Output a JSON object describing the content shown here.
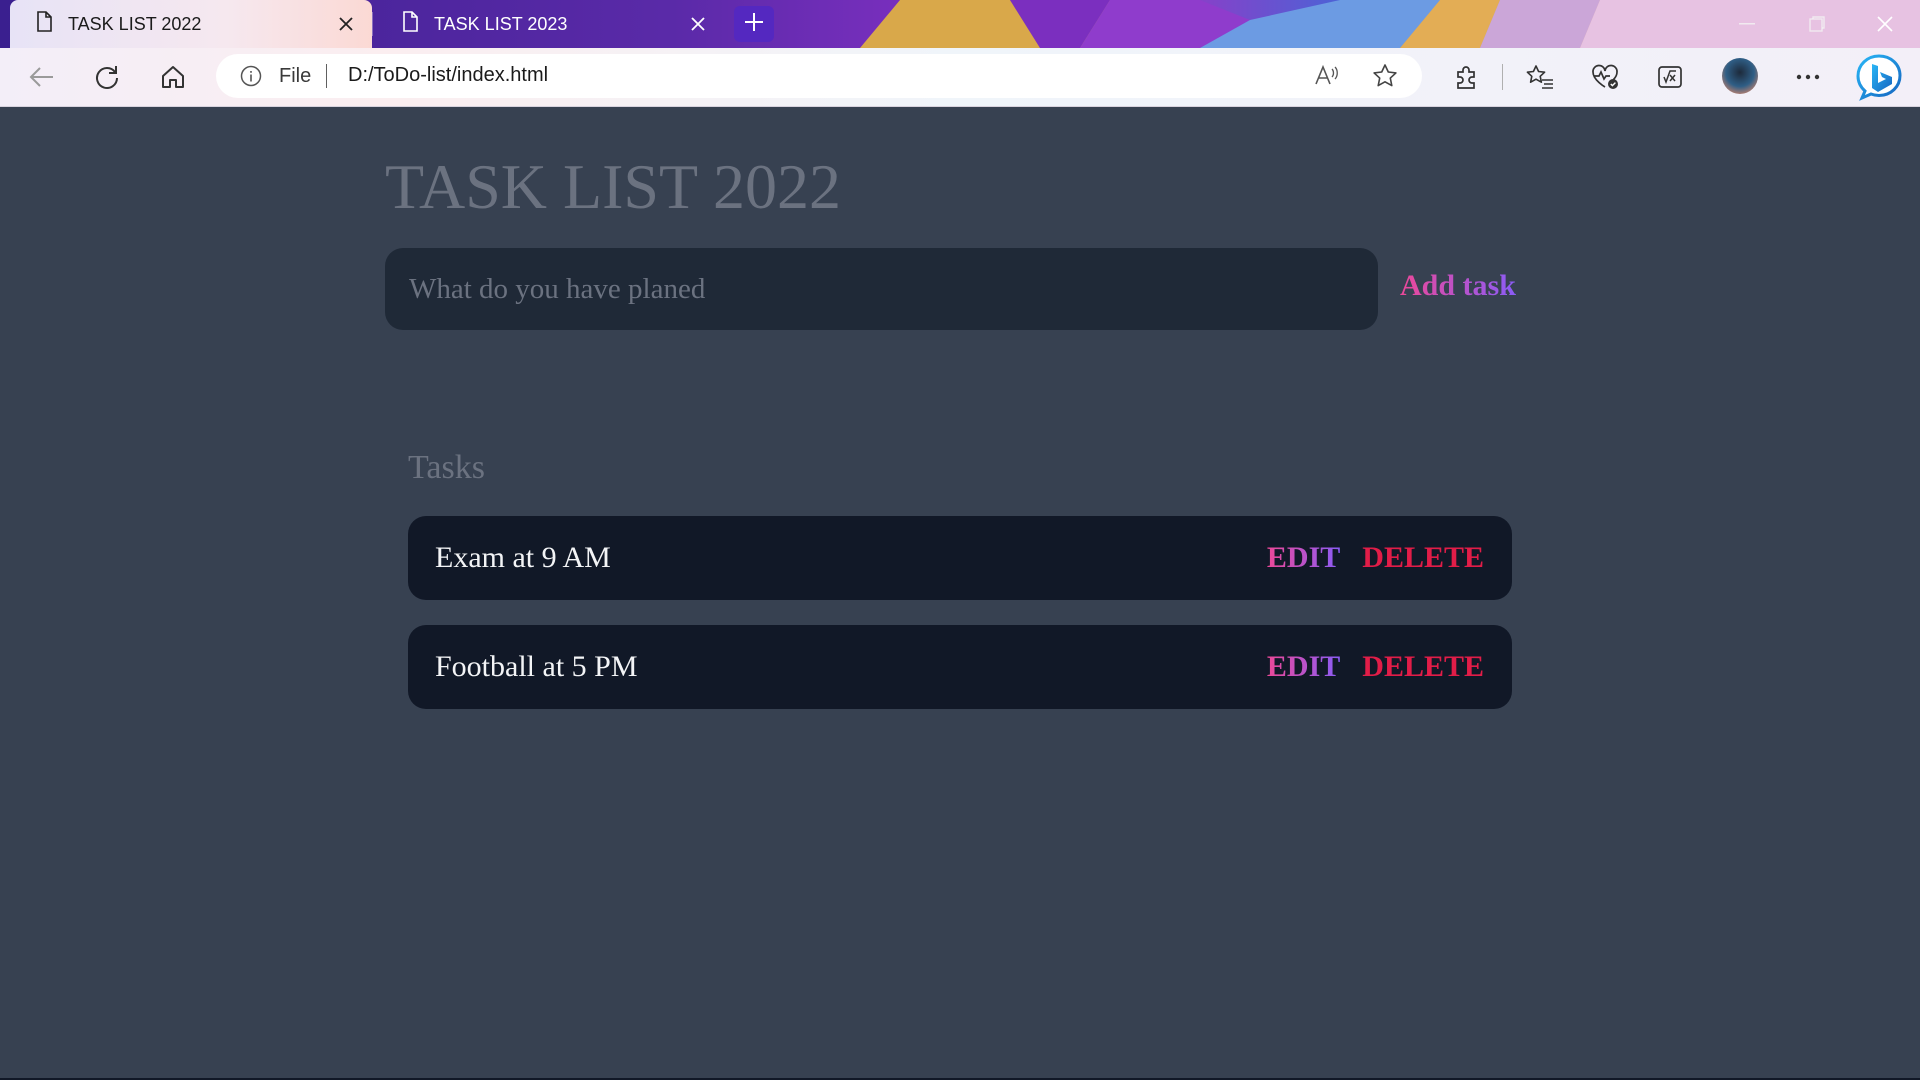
{
  "browser": {
    "tabs": [
      {
        "title": "TASK LIST 2022",
        "active": true
      },
      {
        "title": "TASK LIST 2023",
        "active": false
      }
    ],
    "address": {
      "scheme_label": "File",
      "url": "D:/ToDo-list/index.html"
    }
  },
  "app": {
    "title": "TASK LIST 2022",
    "new_task": {
      "placeholder": "What do you have planed",
      "value": ""
    },
    "add_button": "Add task",
    "section_title": "Tasks",
    "tasks": [
      {
        "text": "Exam at 9 AM",
        "edit_label": "EDIT",
        "delete_label": "DELETE"
      },
      {
        "text": "Football at 5 PM",
        "edit_label": "EDIT",
        "delete_label": "DELETE"
      }
    ]
  },
  "colors": {
    "page_bg": "#374151",
    "input_bg": "#1f2937",
    "task_bg": "#111827",
    "accent_gradient_start": "#ec4899",
    "accent_gradient_end": "#8b5cf6",
    "delete_color": "#e11d48"
  },
  "icons": {
    "tab": "document-icon",
    "close": "close-icon",
    "new_tab": "plus-icon",
    "back": "back-arrow-icon",
    "refresh": "refresh-icon",
    "home": "home-icon",
    "info": "info-icon",
    "read_aloud": "read-aloud-icon",
    "favorite": "star-icon",
    "extensions": "puzzle-icon",
    "favorites": "favorites-list-icon",
    "performance": "heart-pulse-icon",
    "math_solver": "math-solver-icon",
    "more": "more-icon",
    "bing": "bing-icon"
  }
}
